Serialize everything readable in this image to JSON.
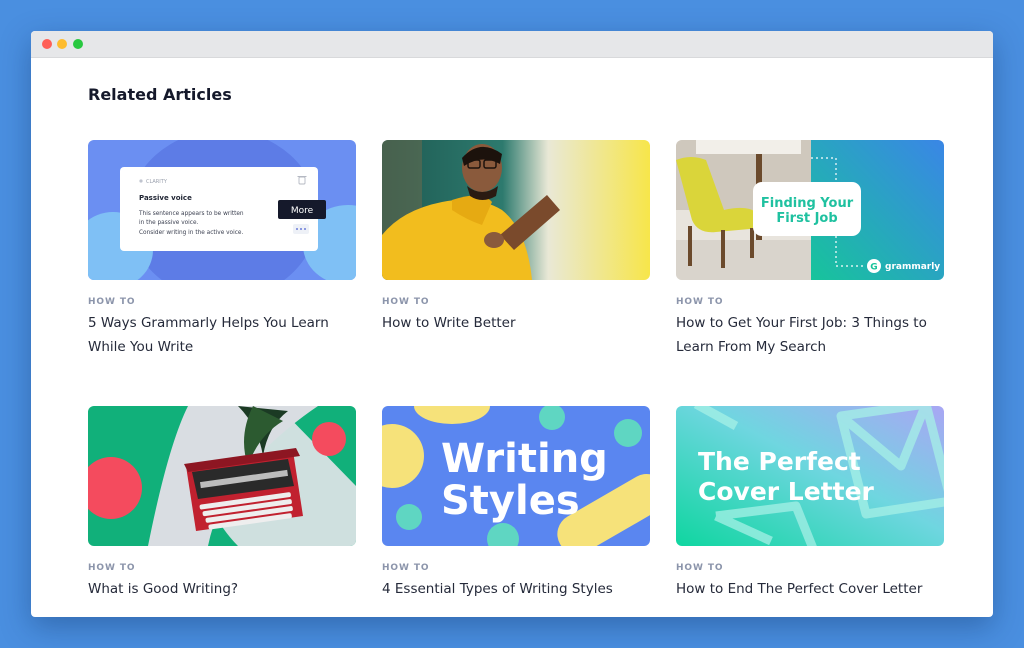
{
  "section_title": "Related Articles",
  "articles": [
    {
      "category": "HOW TO",
      "title": "5 Ways Grammarly Helps You Learn While You Write",
      "thumbnail": {
        "card_label": "CLARITY",
        "heading": "Passive voice",
        "body_line1": "This sentence appears to be written",
        "body_line2": "in the passive voice.",
        "body_line3": "Consider writing in the active voice.",
        "tooltip": "More"
      }
    },
    {
      "category": "HOW TO",
      "title": "How to Write Better"
    },
    {
      "category": "HOW TO",
      "title": "How to Get Your First Job: 3 Things to Learn From My Search",
      "thumbnail": {
        "banner_line1": "Finding Your",
        "banner_line2": "First Job",
        "brand": "grammarly"
      }
    },
    {
      "category": "HOW TO",
      "title": "What is Good Writing?"
    },
    {
      "category": "HOW TO",
      "title": "4 Essential Types of Writing Styles",
      "thumbnail": {
        "line1": "Writing",
        "line2": "Styles"
      }
    },
    {
      "category": "HOW TO",
      "title": "How to End The Perfect Cover Letter",
      "thumbnail": {
        "line1": "The Perfect",
        "line2": "Cover Letter"
      }
    }
  ],
  "colors": {
    "page_background": "#4a8fe0",
    "grammarly_green": "#15c39a",
    "accent_blue": "#5b7ff0"
  }
}
